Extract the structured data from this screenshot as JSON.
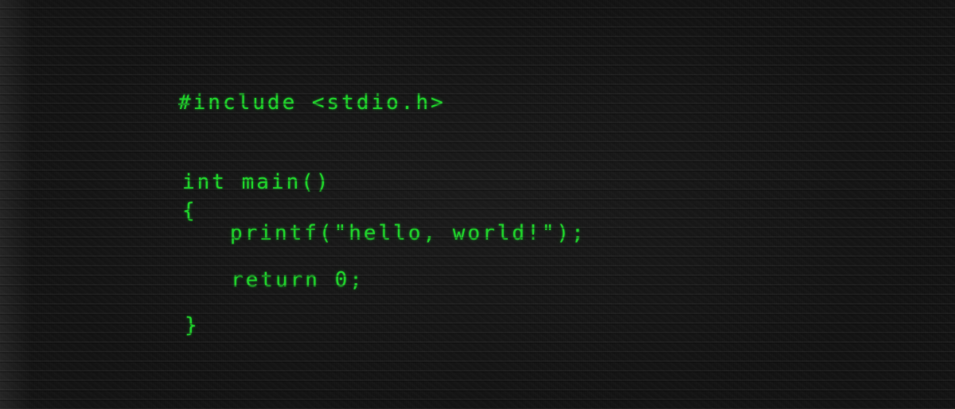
{
  "code": {
    "lines": {
      "include": "#include <stdio.h>",
      "signature": "int main()",
      "open_brace": "{",
      "printf": "printf(\"hello, world!\");",
      "return": "return 0;",
      "close_brace": "}"
    }
  },
  "colors": {
    "text": "#1fd12a",
    "background": "#111111"
  }
}
